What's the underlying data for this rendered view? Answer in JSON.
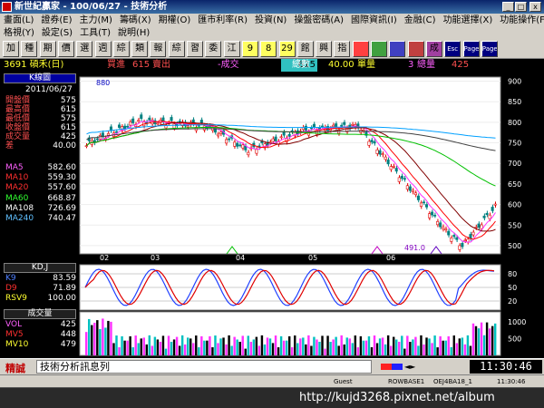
{
  "window": {
    "title": "新世紀贏家 - 100/06/27 - 技術分析",
    "min": "_",
    "max": "□",
    "close": "x"
  },
  "menu": [
    "畫面(L)",
    "證券(E)",
    "主力(M)",
    "籌碼(X)",
    "期權(O)",
    "匯市利率(R)",
    "投資(N)",
    "操盤密碼(A)",
    "國際資訊(I)",
    "金融(C)",
    "功能選擇(X)",
    "功能操作(F)"
  ],
  "menu2": [
    "格視(Y)",
    "設定(S)",
    "工具(T)",
    "說明(H)"
  ],
  "toolbar": [
    "加",
    "種",
    "期",
    "價",
    "選",
    "週",
    "綜",
    "類",
    "報",
    "綜",
    "習",
    "委",
    "江",
    "9",
    "8",
    "29",
    "館",
    "興",
    "指",
    "",
    "",
    "",
    "",
    "成",
    "Esc",
    "Page",
    "Page"
  ],
  "info": {
    "code": "3691 碩禾(日)",
    "buy_label": "買進",
    "buy": "615",
    "sell_label": "賣出",
    "change_label": "-成交",
    "change": "615",
    "volume_label": "總數",
    "volume": "40.00",
    "unit_label": "單量",
    "unit": "3",
    "total_label": "總量",
    "total": "425"
  },
  "left": {
    "k_title": "K線圖",
    "date": "2011/06/27",
    "quote": [
      {
        "label": "開盤價",
        "value": "575",
        "color": "#ff5050"
      },
      {
        "label": "最高價",
        "value": "615",
        "color": "#ff5050"
      },
      {
        "label": "最低價",
        "value": "575",
        "color": "#ff5050"
      },
      {
        "label": "收盤價",
        "value": "615",
        "color": "#ff5050"
      },
      {
        "label": "成交量",
        "value": "425",
        "color": "#ff5050"
      },
      {
        "label": "差",
        "value": "40.00",
        "color": "#ff5050"
      }
    ],
    "ma": [
      {
        "label": "MA5",
        "value": "582.60",
        "color": "#ff60ff"
      },
      {
        "label": "MA10",
        "value": "559.30",
        "color": "#ff3030"
      },
      {
        "label": "MA20",
        "value": "557.60",
        "color": "#ff3030"
      },
      {
        "label": "MA60",
        "value": "668.87",
        "color": "#30ff30"
      },
      {
        "label": "MA108",
        "value": "726.69",
        "color": "#ffffff"
      },
      {
        "label": "MA240",
        "value": "740.47",
        "color": "#60c0ff"
      }
    ],
    "kd_title": "KD,J",
    "kd": [
      {
        "label": "K9",
        "value": "83.59",
        "color": "#5080ff"
      },
      {
        "label": "D9",
        "value": "71.89",
        "color": "#ff3030"
      },
      {
        "label": "RSV9",
        "value": "100.00",
        "color": "#ffff30"
      }
    ],
    "vol_title": "成交量",
    "vol": [
      {
        "label": "VOL",
        "value": "425",
        "color": "#ff60ff"
      },
      {
        "label": "MV5",
        "value": "448",
        "color": "#ff3030"
      },
      {
        "label": "MV10",
        "value": "479",
        "color": "#ffff30"
      }
    ]
  },
  "chart_data": {
    "type": "candlestick",
    "price_ticks": [
      "900",
      "850",
      "800",
      "750",
      "700",
      "650",
      "600",
      "550",
      "500"
    ],
    "ylim": [
      480,
      910
    ],
    "x_ticks": [
      "02",
      "03",
      "04",
      "05",
      "06"
    ],
    "high_label": "880",
    "low_label": "491.0",
    "kd_ticks": [
      "80",
      "50",
      "20"
    ],
    "vol_ticks": [
      "1000",
      "500"
    ]
  },
  "status": {
    "name": "精誠",
    "message": "技術分析訊息列",
    "time": "11:30:46"
  },
  "status2": {
    "user": "Guest",
    "server": "ROWBASE1",
    "conn": "OEJ4BA18_1",
    "time": "11:30:46"
  },
  "watermark": "http://kujd3268.pixnet.net/album"
}
